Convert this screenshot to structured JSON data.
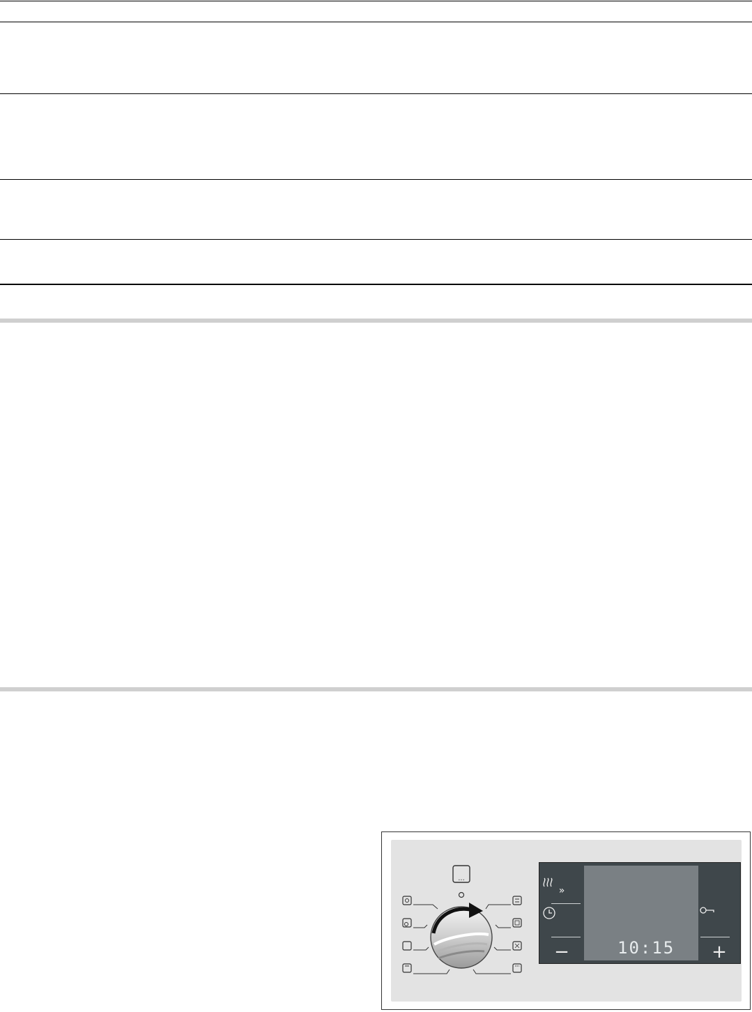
{
  "control_panel": {
    "display": {
      "time": "10:15"
    },
    "buttons": {
      "rapid_heat": "»",
      "minus": "−",
      "plus": "+"
    },
    "selector_icons": [
      "defrost-icon",
      "hot-air-grilling-icon",
      "top-bottom-heat-icon",
      "bottom-heat-icon",
      "pizza-setting-icon",
      "3d-hot-air-icon",
      "full-surface-grill-icon",
      "centre-area-grill-icon"
    ],
    "colors": {
      "panel": "#e3e3e3",
      "control_box": "#3f474b",
      "display": "#7a8084",
      "digits": "#e8ecee"
    }
  }
}
